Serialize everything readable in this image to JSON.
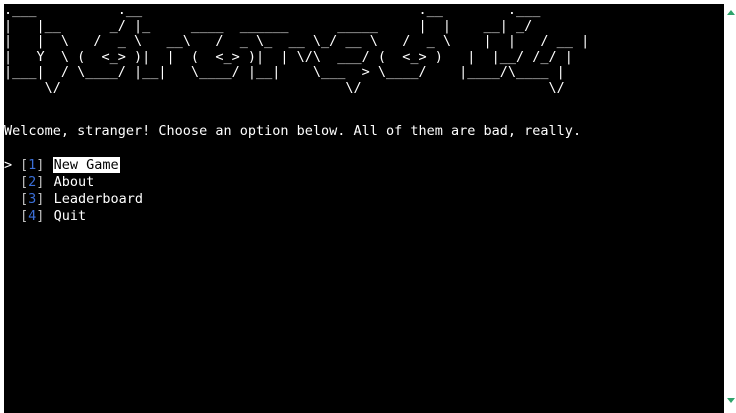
{
  "banner": {
    "lines": [
      ".___          .__                                  .__        .___",
      "|   |__      _/ |_     ____  ______      _____     |  |    __| _/",
      "|   |  \\   /  _ \\   __\\   /  _ \\_  __ \\_/ __ \\   /  _ \\    |  |   / __ |",
      "|   Y  \\ (  <_> )|  |  (  <_> )|  | \\/\\  ___/ (  <_> )   |  |__/ /_/ |",
      "|___|  / \\____/ |__|   \\____/ |__|    \\___  > \\____/    |____/\\____ |",
      "     \\/                                   \\/                       \\/",
      ""
    ]
  },
  "welcome": "Welcome, stranger! Choose an option below. All of them are bad, really.",
  "menu": {
    "cursor": ">",
    "bracket_open": "[",
    "bracket_close": "]",
    "selected_index": 0,
    "items": [
      {
        "number": "1",
        "label": "New Game"
      },
      {
        "number": "2",
        "label": "About"
      },
      {
        "number": "3",
        "label": "Leaderboard"
      },
      {
        "number": "4",
        "label": "Quit"
      }
    ]
  },
  "colors": {
    "background": "#000000",
    "text": "#ffffff",
    "number": "#3b6fd8",
    "selection_bg": "#ffffff",
    "selection_fg": "#000000",
    "scroll_marker": "#2ea36b"
  }
}
